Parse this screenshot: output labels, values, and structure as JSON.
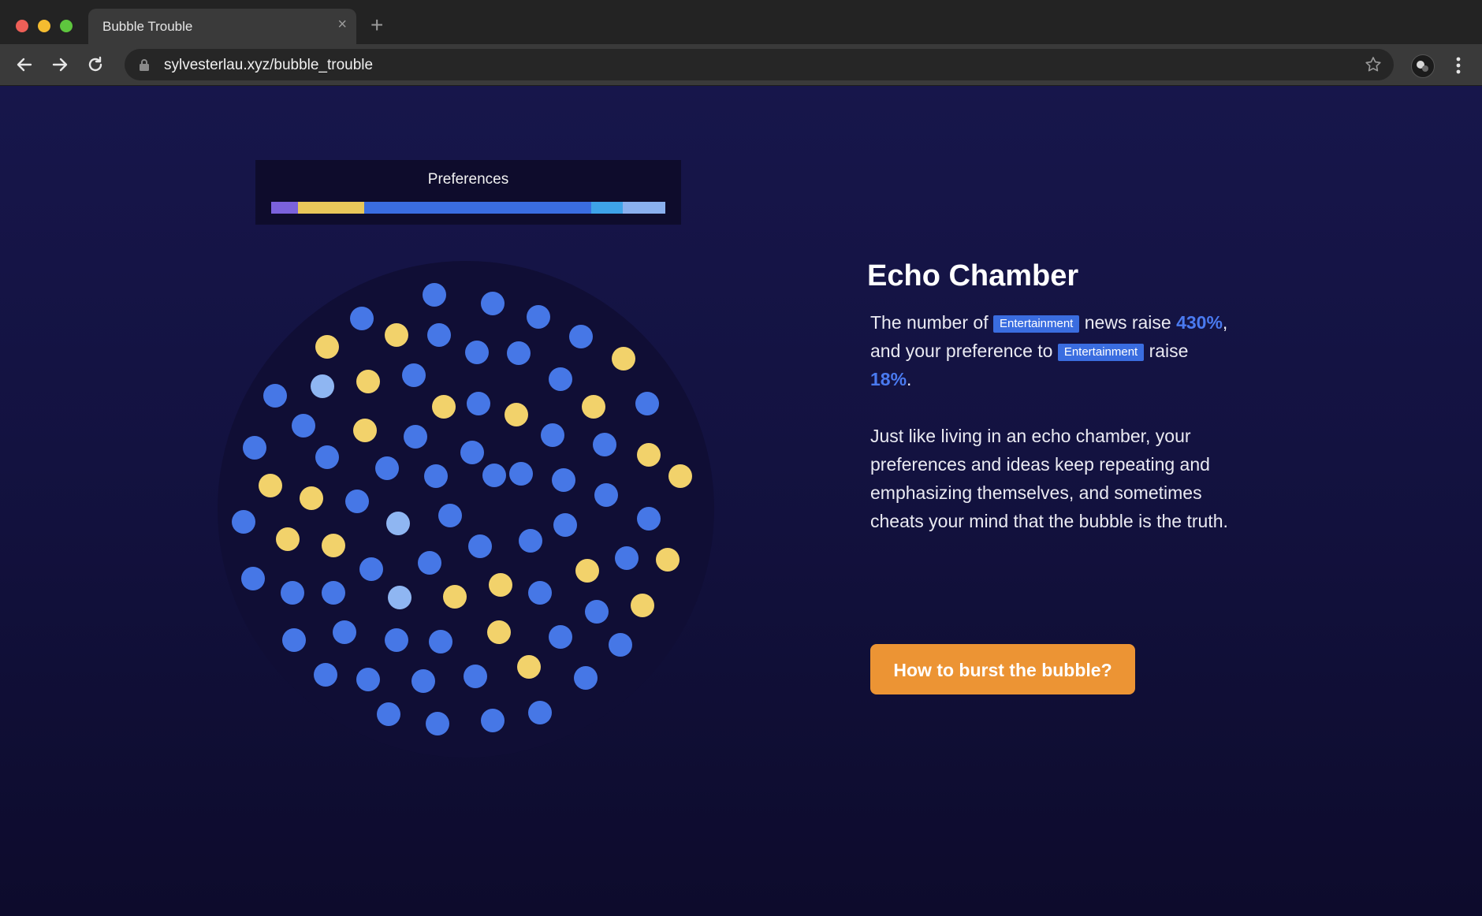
{
  "browser": {
    "tab_title": "Bubble Trouble",
    "tab_close": "×",
    "new_tab": "+",
    "url": "sylvesterlau.xyz/bubble_trouble",
    "icons": [
      "back-arrow-icon",
      "forward-arrow-icon",
      "reload-icon",
      "lock-icon",
      "star-icon",
      "extension-icon",
      "more-vert-icon"
    ]
  },
  "preferences": {
    "title": "Preferences",
    "segments": [
      {
        "color": "#7b62dc",
        "fraction": 0.068
      },
      {
        "color": "#e8c75a",
        "fraction": 0.168
      },
      {
        "color": "#3a6de0",
        "fraction": 0.576
      },
      {
        "color": "#3ea3e8",
        "fraction": 0.08
      },
      {
        "color": "#8ab0ee",
        "fraction": 0.108
      }
    ]
  },
  "bubble": {
    "colors": {
      "blue": "#4677e6",
      "yellow": "#f2d26b",
      "light": "#8fb6f2"
    },
    "dot_count": 88
  },
  "info": {
    "title": "Echo Chamber",
    "p1_before_chip1": "The number of ",
    "chip1": "Entertainment",
    "p1_after_chip1": " news raise ",
    "stat1": "430%",
    "p1_mid": ", and your preference to ",
    "chip2": "Entertainment",
    "p1_after_chip2": " raise ",
    "stat2": "18%",
    "p1_end": ".",
    "p2": "Just like living in an echo chamber, your preferences and ideas keep repeating and emphasizing themselves, and sometimes cheats your mind that the bubble is the truth."
  },
  "cta": {
    "label": "How to burst the bubble?"
  }
}
